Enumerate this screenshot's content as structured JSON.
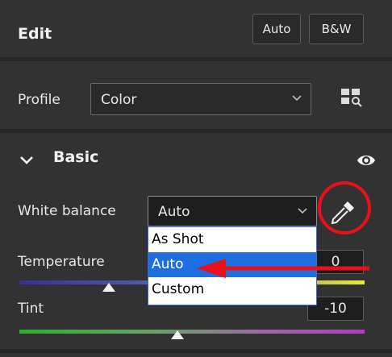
{
  "header": {
    "title": "Edit",
    "auto_label": "Auto",
    "bw_label": "B&W"
  },
  "profile": {
    "label": "Profile",
    "value": "Color",
    "browser_icon": "profile-browser-icon"
  },
  "basic": {
    "title": "Basic",
    "white_balance": {
      "label": "White balance",
      "value": "Auto",
      "options": [
        "As Shot",
        "Auto",
        "Custom"
      ],
      "selected": "Auto"
    },
    "temperature": {
      "label": "Temperature",
      "value": "0"
    },
    "tint": {
      "label": "Tint",
      "value": "-10"
    }
  },
  "annotations": {
    "highlight_color": "#e8101a"
  },
  "colors": {
    "panel_bg": "#323232",
    "separator": "#262626",
    "selection": "#1f6ee0"
  }
}
